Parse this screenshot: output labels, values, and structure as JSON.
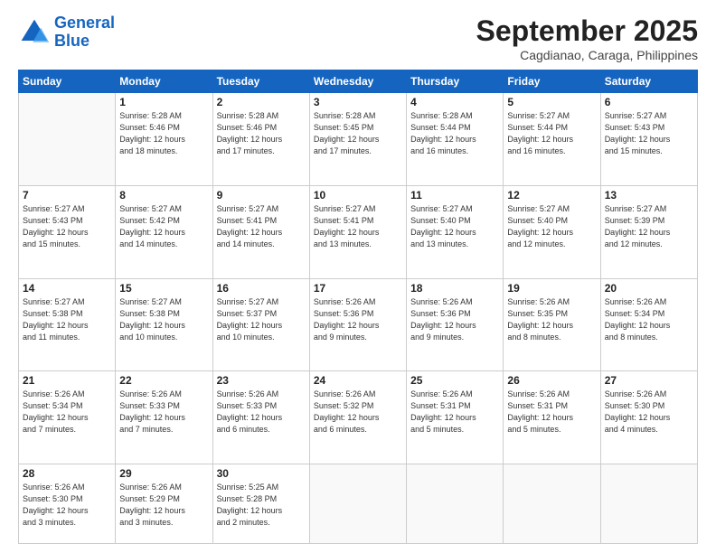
{
  "logo": {
    "line1": "General",
    "line2": "Blue"
  },
  "title": "September 2025",
  "subtitle": "Cagdianao, Caraga, Philippines",
  "headers": [
    "Sunday",
    "Monday",
    "Tuesday",
    "Wednesday",
    "Thursday",
    "Friday",
    "Saturday"
  ],
  "weeks": [
    [
      {
        "day": "",
        "info": ""
      },
      {
        "day": "1",
        "info": "Sunrise: 5:28 AM\nSunset: 5:46 PM\nDaylight: 12 hours\nand 18 minutes."
      },
      {
        "day": "2",
        "info": "Sunrise: 5:28 AM\nSunset: 5:46 PM\nDaylight: 12 hours\nand 17 minutes."
      },
      {
        "day": "3",
        "info": "Sunrise: 5:28 AM\nSunset: 5:45 PM\nDaylight: 12 hours\nand 17 minutes."
      },
      {
        "day": "4",
        "info": "Sunrise: 5:28 AM\nSunset: 5:44 PM\nDaylight: 12 hours\nand 16 minutes."
      },
      {
        "day": "5",
        "info": "Sunrise: 5:27 AM\nSunset: 5:44 PM\nDaylight: 12 hours\nand 16 minutes."
      },
      {
        "day": "6",
        "info": "Sunrise: 5:27 AM\nSunset: 5:43 PM\nDaylight: 12 hours\nand 15 minutes."
      }
    ],
    [
      {
        "day": "7",
        "info": "Sunrise: 5:27 AM\nSunset: 5:43 PM\nDaylight: 12 hours\nand 15 minutes."
      },
      {
        "day": "8",
        "info": "Sunrise: 5:27 AM\nSunset: 5:42 PM\nDaylight: 12 hours\nand 14 minutes."
      },
      {
        "day": "9",
        "info": "Sunrise: 5:27 AM\nSunset: 5:41 PM\nDaylight: 12 hours\nand 14 minutes."
      },
      {
        "day": "10",
        "info": "Sunrise: 5:27 AM\nSunset: 5:41 PM\nDaylight: 12 hours\nand 13 minutes."
      },
      {
        "day": "11",
        "info": "Sunrise: 5:27 AM\nSunset: 5:40 PM\nDaylight: 12 hours\nand 13 minutes."
      },
      {
        "day": "12",
        "info": "Sunrise: 5:27 AM\nSunset: 5:40 PM\nDaylight: 12 hours\nand 12 minutes."
      },
      {
        "day": "13",
        "info": "Sunrise: 5:27 AM\nSunset: 5:39 PM\nDaylight: 12 hours\nand 12 minutes."
      }
    ],
    [
      {
        "day": "14",
        "info": "Sunrise: 5:27 AM\nSunset: 5:38 PM\nDaylight: 12 hours\nand 11 minutes."
      },
      {
        "day": "15",
        "info": "Sunrise: 5:27 AM\nSunset: 5:38 PM\nDaylight: 12 hours\nand 10 minutes."
      },
      {
        "day": "16",
        "info": "Sunrise: 5:27 AM\nSunset: 5:37 PM\nDaylight: 12 hours\nand 10 minutes."
      },
      {
        "day": "17",
        "info": "Sunrise: 5:26 AM\nSunset: 5:36 PM\nDaylight: 12 hours\nand 9 minutes."
      },
      {
        "day": "18",
        "info": "Sunrise: 5:26 AM\nSunset: 5:36 PM\nDaylight: 12 hours\nand 9 minutes."
      },
      {
        "day": "19",
        "info": "Sunrise: 5:26 AM\nSunset: 5:35 PM\nDaylight: 12 hours\nand 8 minutes."
      },
      {
        "day": "20",
        "info": "Sunrise: 5:26 AM\nSunset: 5:34 PM\nDaylight: 12 hours\nand 8 minutes."
      }
    ],
    [
      {
        "day": "21",
        "info": "Sunrise: 5:26 AM\nSunset: 5:34 PM\nDaylight: 12 hours\nand 7 minutes."
      },
      {
        "day": "22",
        "info": "Sunrise: 5:26 AM\nSunset: 5:33 PM\nDaylight: 12 hours\nand 7 minutes."
      },
      {
        "day": "23",
        "info": "Sunrise: 5:26 AM\nSunset: 5:33 PM\nDaylight: 12 hours\nand 6 minutes."
      },
      {
        "day": "24",
        "info": "Sunrise: 5:26 AM\nSunset: 5:32 PM\nDaylight: 12 hours\nand 6 minutes."
      },
      {
        "day": "25",
        "info": "Sunrise: 5:26 AM\nSunset: 5:31 PM\nDaylight: 12 hours\nand 5 minutes."
      },
      {
        "day": "26",
        "info": "Sunrise: 5:26 AM\nSunset: 5:31 PM\nDaylight: 12 hours\nand 5 minutes."
      },
      {
        "day": "27",
        "info": "Sunrise: 5:26 AM\nSunset: 5:30 PM\nDaylight: 12 hours\nand 4 minutes."
      }
    ],
    [
      {
        "day": "28",
        "info": "Sunrise: 5:26 AM\nSunset: 5:30 PM\nDaylight: 12 hours\nand 3 minutes."
      },
      {
        "day": "29",
        "info": "Sunrise: 5:26 AM\nSunset: 5:29 PM\nDaylight: 12 hours\nand 3 minutes."
      },
      {
        "day": "30",
        "info": "Sunrise: 5:25 AM\nSunset: 5:28 PM\nDaylight: 12 hours\nand 2 minutes."
      },
      {
        "day": "",
        "info": ""
      },
      {
        "day": "",
        "info": ""
      },
      {
        "day": "",
        "info": ""
      },
      {
        "day": "",
        "info": ""
      }
    ]
  ]
}
